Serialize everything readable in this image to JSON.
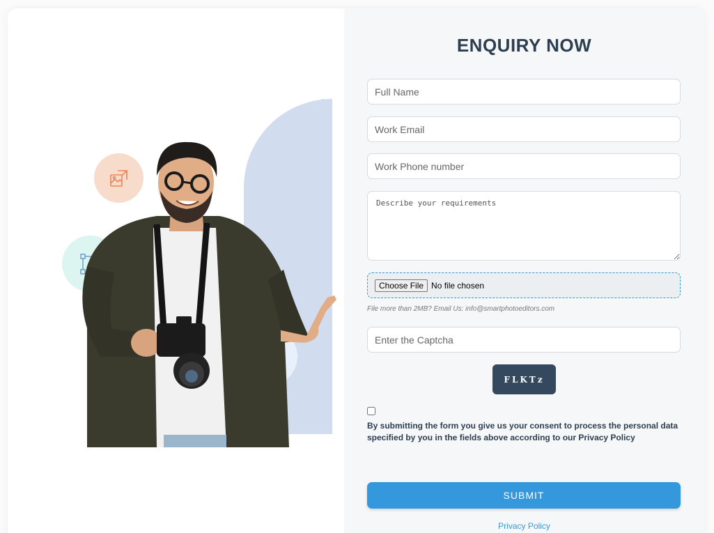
{
  "form": {
    "title": "ENQUIRY NOW",
    "full_name_placeholder": "Full Name",
    "work_email_placeholder": "Work Email",
    "work_phone_placeholder": "Work Phone number",
    "requirements_placeholder": "Describe your requirements",
    "file_button_label": "Choose File",
    "file_status": "No file chosen",
    "file_hint": "File more than 2MB? Email Us: info@smartphotoeditors.com",
    "captcha_placeholder": "Enter the Captcha",
    "captcha_code": "FLKTz",
    "consent_text": "By submitting the form you give us your consent to process the personal data specified by you in the fields above according to our Privacy Policy",
    "consent_checked": false,
    "submit_label": "SUBMIT",
    "privacy_link": "Privacy Policy"
  },
  "illustration": {
    "icons": [
      "image-resize-icon",
      "vector-pen-icon",
      "magic-wand-icon"
    ]
  },
  "colors": {
    "title": "#2c3e50",
    "accent": "#3598dc",
    "captcha_bg": "#34495e",
    "arch": "#d1ddef",
    "form_panel_bg": "#f6f7f9"
  }
}
